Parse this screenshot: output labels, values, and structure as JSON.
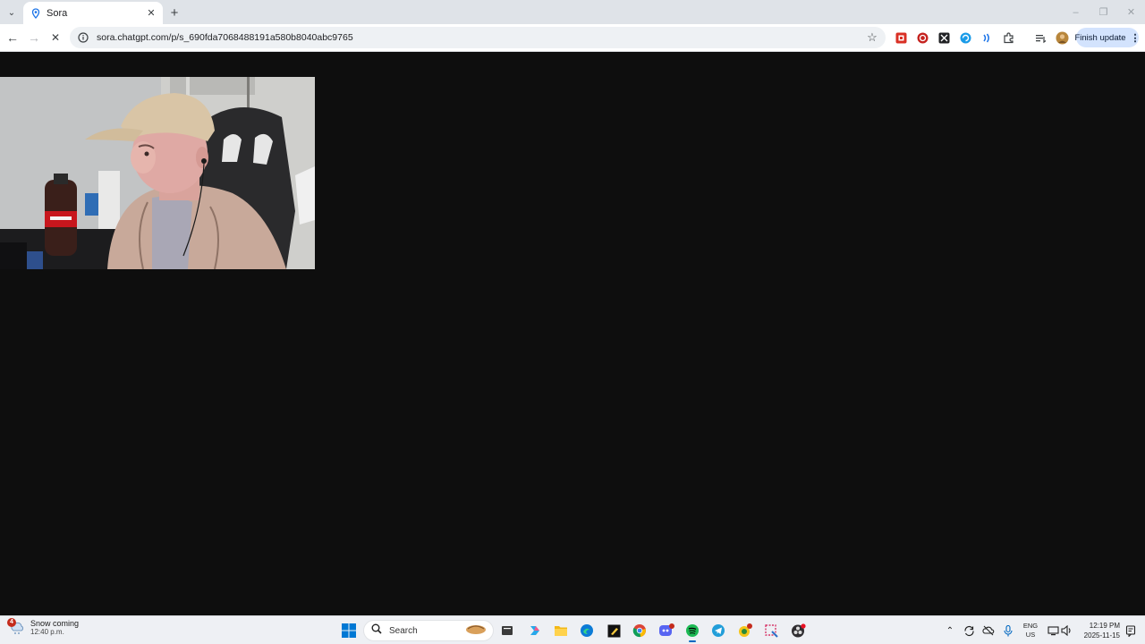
{
  "browser": {
    "tab": {
      "title": "Sora",
      "favicon": "sora-pin-icon"
    },
    "url": "sora.chatgpt.com/p/s_690fda7068488191a580b8040abc9765",
    "update_button_label": "Finish update",
    "extensions": [
      "extension-red-square-icon",
      "extension-red-circle-icon",
      "extension-box-icon",
      "extension-blue-swirl-icon",
      "extension-waves-icon",
      "extensions-puzzle-icon",
      "reading-list-icon",
      "profile-avatar"
    ]
  },
  "content": {
    "background_color": "#0e0e0e",
    "video": {
      "description_icon": "video-frame"
    }
  },
  "taskbar": {
    "weather": {
      "badge": "4",
      "title": "Snow coming",
      "subtitle": "12:40 p.m."
    },
    "search_label": "Search",
    "language": {
      "line1": "ENG",
      "line2": "US"
    },
    "clock": {
      "time": "12:19 PM",
      "date": "2025-11-15"
    },
    "apps": [
      "windows-start-icon",
      "search-icon",
      "file-icon",
      "copilot-icon",
      "file-explorer-icon",
      "edge-icon",
      "notepad-icon",
      "chrome-icon",
      "discord-icon",
      "spotify-icon",
      "telegram-icon",
      "app-badge-icon",
      "snipping-tool-icon",
      "obs-icon"
    ]
  }
}
